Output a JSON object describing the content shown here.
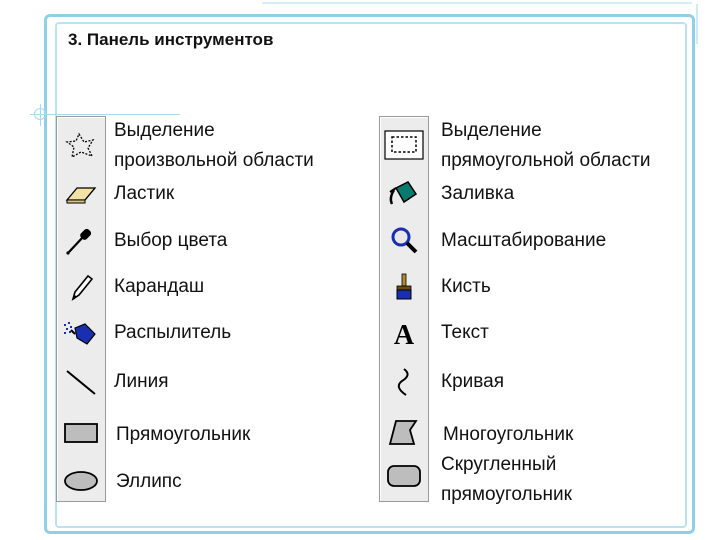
{
  "title": "3. Панель инструментов",
  "left_tools": [
    {
      "icon": "free-select-icon",
      "label_line1": "Выделение",
      "label_line2": "произвольной области"
    },
    {
      "icon": "eraser-icon",
      "label": "Ластик"
    },
    {
      "icon": "eyedropper-icon",
      "label": "Выбор цвета"
    },
    {
      "icon": "pencil-icon",
      "label": "Карандаш"
    },
    {
      "icon": "airbrush-icon",
      "label": "Распылитель"
    },
    {
      "icon": "line-icon",
      "label": "Линия"
    },
    {
      "icon": "rectangle-icon",
      "label": "Прямоугольник"
    },
    {
      "icon": "ellipse-icon",
      "label": "Эллипс"
    }
  ],
  "right_tools": [
    {
      "icon": "rect-select-icon",
      "label_line1": "Выделение",
      "label_line2": "прямоугольной области"
    },
    {
      "icon": "fill-bucket-icon",
      "label": "Заливка"
    },
    {
      "icon": "magnifier-icon",
      "label": "Масштабирование"
    },
    {
      "icon": "brush-icon",
      "label": "Кисть"
    },
    {
      "icon": "text-icon",
      "label": "Текст"
    },
    {
      "icon": "curve-icon",
      "label": "Кривая"
    },
    {
      "icon": "polygon-icon",
      "label": "Многоугольник"
    },
    {
      "icon": "rounded-rect-icon",
      "label_line1": "Скругленный",
      "label_line2": "прямоугольник"
    }
  ]
}
